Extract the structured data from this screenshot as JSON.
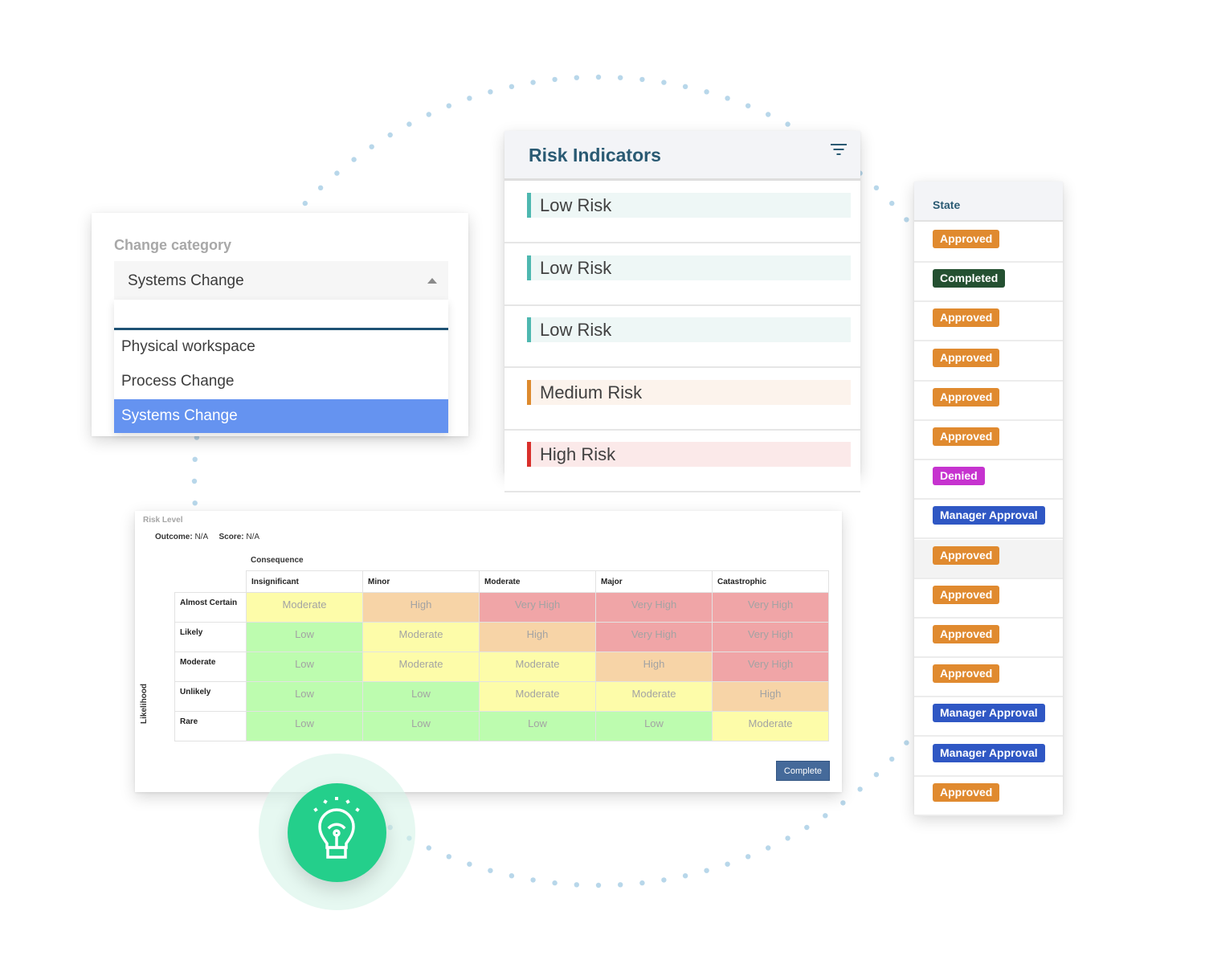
{
  "change_category": {
    "label": "Change category",
    "selected_value": "Systems Change",
    "search_value": "",
    "options": [
      {
        "label": "Physical workspace",
        "selected": false
      },
      {
        "label": "Process Change",
        "selected": false
      },
      {
        "label": "Systems Change",
        "selected": true
      }
    ]
  },
  "risk_indicators": {
    "title": "Risk Indicators",
    "filter_icon": "filter-icon",
    "items": [
      {
        "label": "Low Risk",
        "level": "low",
        "bar_color": "#4eb8b0",
        "bg_color": "#eef7f6"
      },
      {
        "label": "Low Risk",
        "level": "low",
        "bar_color": "#4eb8b0",
        "bg_color": "#eef7f6"
      },
      {
        "label": "Low Risk",
        "level": "low",
        "bar_color": "#4eb8b0",
        "bg_color": "#eef7f6"
      },
      {
        "label": "Medium Risk",
        "level": "medium",
        "bar_color": "#dd8a2e",
        "bg_color": "#fcf3ec"
      },
      {
        "label": "High Risk",
        "level": "high",
        "bar_color": "#d9302c",
        "bg_color": "#fbe9e9"
      }
    ]
  },
  "state_table": {
    "header": "State",
    "rows": [
      {
        "label": "Approved",
        "color": "#e08a2f"
      },
      {
        "label": "Completed",
        "color": "#245031"
      },
      {
        "label": "Approved",
        "color": "#e08a2f"
      },
      {
        "label": "Approved",
        "color": "#e08a2f"
      },
      {
        "label": "Approved",
        "color": "#e08a2f"
      },
      {
        "label": "Approved",
        "color": "#e08a2f"
      },
      {
        "label": "Denied",
        "color": "#c633cf"
      },
      {
        "label": "Manager Approval",
        "color": "#2f57c4"
      },
      {
        "label": "Approved",
        "color": "#e08a2f",
        "highlighted": true
      },
      {
        "label": "Approved",
        "color": "#e08a2f"
      },
      {
        "label": "Approved",
        "color": "#e08a2f"
      },
      {
        "label": "Approved",
        "color": "#e08a2f"
      },
      {
        "label": "Manager Approval",
        "color": "#2f57c4"
      },
      {
        "label": "Manager Approval",
        "color": "#2f57c4"
      },
      {
        "label": "Approved",
        "color": "#e08a2f"
      }
    ]
  },
  "risk_matrix": {
    "title": "Risk Level",
    "outcome_label": "Outcome:",
    "outcome_value": "N/A",
    "score_label": "Score:",
    "score_value": "N/A",
    "consequence_label": "Consequence",
    "likelihood_label": "Likelihood",
    "columns": [
      "Insignificant",
      "Minor",
      "Moderate",
      "Major",
      "Catastrophic"
    ],
    "rows": [
      {
        "label": "Almost Certain",
        "cells": [
          "Moderate",
          "High",
          "Very High",
          "Very High",
          "Very High"
        ]
      },
      {
        "label": "Likely",
        "cells": [
          "Low",
          "Moderate",
          "High",
          "Very High",
          "Very High"
        ]
      },
      {
        "label": "Moderate",
        "cells": [
          "Low",
          "Moderate",
          "Moderate",
          "High",
          "Very High"
        ]
      },
      {
        "label": "Unlikely",
        "cells": [
          "Low",
          "Low",
          "Moderate",
          "Moderate",
          "High"
        ]
      },
      {
        "label": "Rare",
        "cells": [
          "Low",
          "Low",
          "Low",
          "Low",
          "Moderate"
        ]
      }
    ],
    "level_colors": {
      "Low": "#bdfcaf",
      "Moderate": "#fdfca9",
      "High": "#f7d4a7",
      "Very High": "#f0a5a7"
    },
    "complete_button": "Complete"
  },
  "decor": {
    "ring_dot_color": "#b8d7ea",
    "bulb_color": "#24cf8b",
    "bulb_icon": "lightbulb-icon"
  }
}
